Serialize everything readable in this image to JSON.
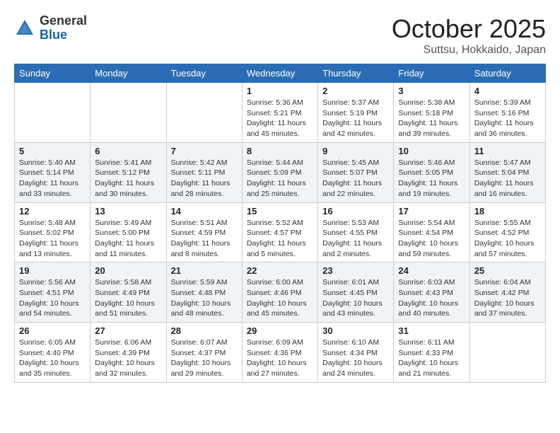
{
  "header": {
    "logo_general": "General",
    "logo_blue": "Blue",
    "month": "October 2025",
    "location": "Suttsu, Hokkaido, Japan"
  },
  "weekdays": [
    "Sunday",
    "Monday",
    "Tuesday",
    "Wednesday",
    "Thursday",
    "Friday",
    "Saturday"
  ],
  "weeks": [
    [
      {
        "day": "",
        "sunrise": "",
        "sunset": "",
        "daylight": ""
      },
      {
        "day": "",
        "sunrise": "",
        "sunset": "",
        "daylight": ""
      },
      {
        "day": "",
        "sunrise": "",
        "sunset": "",
        "daylight": ""
      },
      {
        "day": "1",
        "sunrise": "Sunrise: 5:36 AM",
        "sunset": "Sunset: 5:21 PM",
        "daylight": "Daylight: 11 hours and 45 minutes."
      },
      {
        "day": "2",
        "sunrise": "Sunrise: 5:37 AM",
        "sunset": "Sunset: 5:19 PM",
        "daylight": "Daylight: 11 hours and 42 minutes."
      },
      {
        "day": "3",
        "sunrise": "Sunrise: 5:38 AM",
        "sunset": "Sunset: 5:18 PM",
        "daylight": "Daylight: 11 hours and 39 minutes."
      },
      {
        "day": "4",
        "sunrise": "Sunrise: 5:39 AM",
        "sunset": "Sunset: 5:16 PM",
        "daylight": "Daylight: 11 hours and 36 minutes."
      }
    ],
    [
      {
        "day": "5",
        "sunrise": "Sunrise: 5:40 AM",
        "sunset": "Sunset: 5:14 PM",
        "daylight": "Daylight: 11 hours and 33 minutes."
      },
      {
        "day": "6",
        "sunrise": "Sunrise: 5:41 AM",
        "sunset": "Sunset: 5:12 PM",
        "daylight": "Daylight: 11 hours and 30 minutes."
      },
      {
        "day": "7",
        "sunrise": "Sunrise: 5:42 AM",
        "sunset": "Sunset: 5:11 PM",
        "daylight": "Daylight: 11 hours and 28 minutes."
      },
      {
        "day": "8",
        "sunrise": "Sunrise: 5:44 AM",
        "sunset": "Sunset: 5:09 PM",
        "daylight": "Daylight: 11 hours and 25 minutes."
      },
      {
        "day": "9",
        "sunrise": "Sunrise: 5:45 AM",
        "sunset": "Sunset: 5:07 PM",
        "daylight": "Daylight: 11 hours and 22 minutes."
      },
      {
        "day": "10",
        "sunrise": "Sunrise: 5:46 AM",
        "sunset": "Sunset: 5:05 PM",
        "daylight": "Daylight: 11 hours and 19 minutes."
      },
      {
        "day": "11",
        "sunrise": "Sunrise: 5:47 AM",
        "sunset": "Sunset: 5:04 PM",
        "daylight": "Daylight: 11 hours and 16 minutes."
      }
    ],
    [
      {
        "day": "12",
        "sunrise": "Sunrise: 5:48 AM",
        "sunset": "Sunset: 5:02 PM",
        "daylight": "Daylight: 11 hours and 13 minutes."
      },
      {
        "day": "13",
        "sunrise": "Sunrise: 5:49 AM",
        "sunset": "Sunset: 5:00 PM",
        "daylight": "Daylight: 11 hours and 11 minutes."
      },
      {
        "day": "14",
        "sunrise": "Sunrise: 5:51 AM",
        "sunset": "Sunset: 4:59 PM",
        "daylight": "Daylight: 11 hours and 8 minutes."
      },
      {
        "day": "15",
        "sunrise": "Sunrise: 5:52 AM",
        "sunset": "Sunset: 4:57 PM",
        "daylight": "Daylight: 11 hours and 5 minutes."
      },
      {
        "day": "16",
        "sunrise": "Sunrise: 5:53 AM",
        "sunset": "Sunset: 4:55 PM",
        "daylight": "Daylight: 11 hours and 2 minutes."
      },
      {
        "day": "17",
        "sunrise": "Sunrise: 5:54 AM",
        "sunset": "Sunset: 4:54 PM",
        "daylight": "Daylight: 10 hours and 59 minutes."
      },
      {
        "day": "18",
        "sunrise": "Sunrise: 5:55 AM",
        "sunset": "Sunset: 4:52 PM",
        "daylight": "Daylight: 10 hours and 57 minutes."
      }
    ],
    [
      {
        "day": "19",
        "sunrise": "Sunrise: 5:56 AM",
        "sunset": "Sunset: 4:51 PM",
        "daylight": "Daylight: 10 hours and 54 minutes."
      },
      {
        "day": "20",
        "sunrise": "Sunrise: 5:58 AM",
        "sunset": "Sunset: 4:49 PM",
        "daylight": "Daylight: 10 hours and 51 minutes."
      },
      {
        "day": "21",
        "sunrise": "Sunrise: 5:59 AM",
        "sunset": "Sunset: 4:48 PM",
        "daylight": "Daylight: 10 hours and 48 minutes."
      },
      {
        "day": "22",
        "sunrise": "Sunrise: 6:00 AM",
        "sunset": "Sunset: 4:46 PM",
        "daylight": "Daylight: 10 hours and 45 minutes."
      },
      {
        "day": "23",
        "sunrise": "Sunrise: 6:01 AM",
        "sunset": "Sunset: 4:45 PM",
        "daylight": "Daylight: 10 hours and 43 minutes."
      },
      {
        "day": "24",
        "sunrise": "Sunrise: 6:03 AM",
        "sunset": "Sunset: 4:43 PM",
        "daylight": "Daylight: 10 hours and 40 minutes."
      },
      {
        "day": "25",
        "sunrise": "Sunrise: 6:04 AM",
        "sunset": "Sunset: 4:42 PM",
        "daylight": "Daylight: 10 hours and 37 minutes."
      }
    ],
    [
      {
        "day": "26",
        "sunrise": "Sunrise: 6:05 AM",
        "sunset": "Sunset: 4:40 PM",
        "daylight": "Daylight: 10 hours and 35 minutes."
      },
      {
        "day": "27",
        "sunrise": "Sunrise: 6:06 AM",
        "sunset": "Sunset: 4:39 PM",
        "daylight": "Daylight: 10 hours and 32 minutes."
      },
      {
        "day": "28",
        "sunrise": "Sunrise: 6:07 AM",
        "sunset": "Sunset: 4:37 PM",
        "daylight": "Daylight: 10 hours and 29 minutes."
      },
      {
        "day": "29",
        "sunrise": "Sunrise: 6:09 AM",
        "sunset": "Sunset: 4:36 PM",
        "daylight": "Daylight: 10 hours and 27 minutes."
      },
      {
        "day": "30",
        "sunrise": "Sunrise: 6:10 AM",
        "sunset": "Sunset: 4:34 PM",
        "daylight": "Daylight: 10 hours and 24 minutes."
      },
      {
        "day": "31",
        "sunrise": "Sunrise: 6:11 AM",
        "sunset": "Sunset: 4:33 PM",
        "daylight": "Daylight: 10 hours and 21 minutes."
      },
      {
        "day": "",
        "sunrise": "",
        "sunset": "",
        "daylight": ""
      }
    ]
  ]
}
